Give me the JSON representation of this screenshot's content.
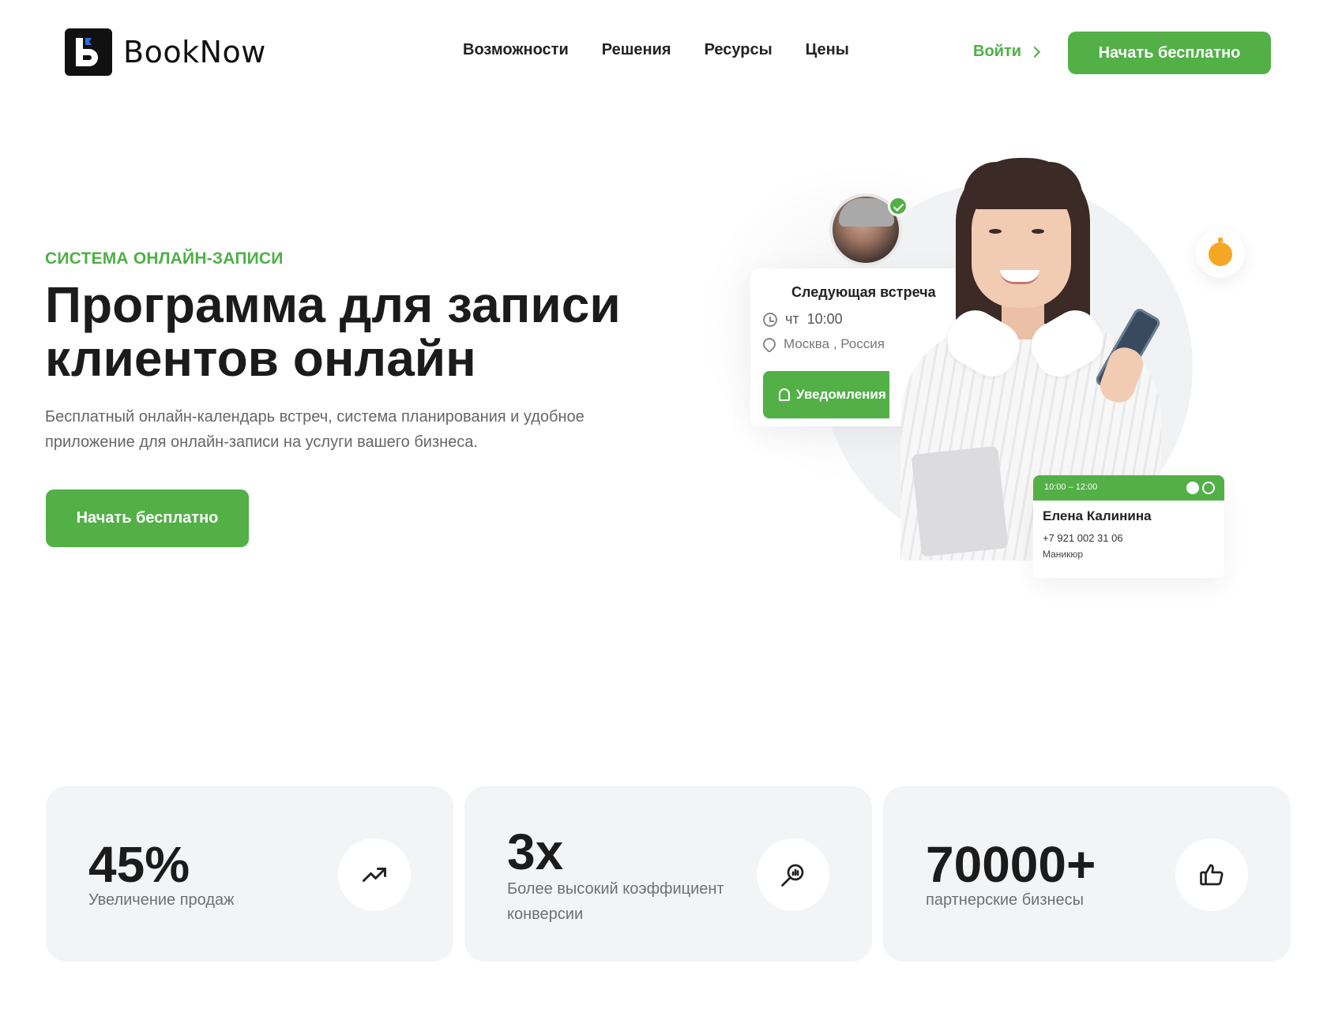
{
  "header": {
    "logo_text": "BookNow",
    "nav": [
      "Возможности",
      "Решения",
      "Ресурсы",
      "Цены"
    ],
    "login_label": "Войти",
    "cta_label": "Начать бесплатно"
  },
  "hero": {
    "eyebrow": "СИСТЕМА ОНЛАЙН-ЗАПИСИ",
    "title": "Программа для записи клиентов онлайн",
    "subtitle": "Бесплатный онлайн-календарь встреч, система планирования и удобное приложение для онлайн-записи на услуги вашего бизнеса.",
    "cta_label": "Начать бесплатно"
  },
  "meeting_card": {
    "title": "Следующая встреча",
    "day": "чт",
    "time": "10:00",
    "location": "Москва , Россия",
    "notify_label": "Уведомления"
  },
  "client_card": {
    "time_range": "10:00 – 12:00",
    "name": "Елена Калинина",
    "phone": "+7 921 002 31 06",
    "service": "Маникюр"
  },
  "stats": [
    {
      "value": "45%",
      "label": "Увеличение продаж",
      "icon": "trending-up-icon"
    },
    {
      "value": "3x",
      "label": "Более высокий коэффициент конверсии",
      "icon": "search-analytics-icon"
    },
    {
      "value": "70000+",
      "label": "партнерские бизнесы",
      "icon": "thumbs-up-icon"
    }
  ],
  "colors": {
    "accent": "#52b047",
    "text": "#1b1b1b",
    "muted": "#707070",
    "card_bg": "#f3f4f5",
    "timer": "#f5a623"
  }
}
